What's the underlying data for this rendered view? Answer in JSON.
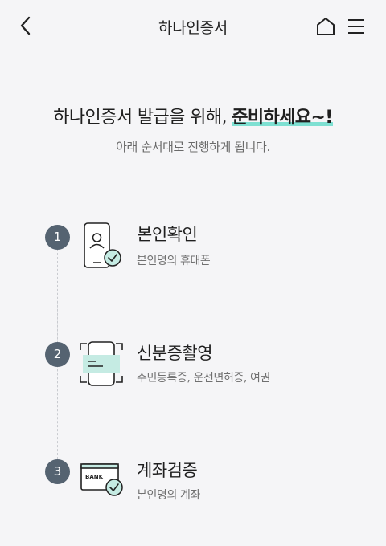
{
  "header": {
    "title": "하나인증서",
    "back_icon": "chevron-left-icon",
    "home_icon": "home-icon",
    "menu_icon": "hamburger-menu-icon"
  },
  "intro": {
    "headline_prefix": "하나인증서 발급을 위해, ",
    "headline_highlight": "준비하세요~!",
    "subline": "아래 순서대로 진행하게 됩니다."
  },
  "steps": [
    {
      "number": "1",
      "title": "본인확인",
      "description": "본인명의 휴대폰",
      "icon": "phone-person-check-icon"
    },
    {
      "number": "2",
      "title": "신분증촬영",
      "description": "주민등록증, 운전면허증, 여권",
      "icon": "id-card-scan-icon"
    },
    {
      "number": "3",
      "title": "계좌검증",
      "description": "본인명의 계좌",
      "icon": "bank-card-check-icon",
      "card_text": "BANK"
    }
  ],
  "colors": {
    "accent": "#7ee0d2",
    "step_badge": "#556371",
    "background": "#f5f5f7"
  }
}
